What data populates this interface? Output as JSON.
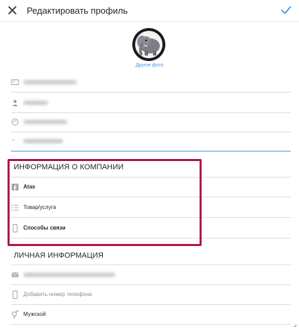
{
  "header": {
    "title": "Редактировать профиль",
    "close_icon": "close-icon",
    "save_icon": "checkmark-icon",
    "accent": "#3897f0"
  },
  "profile": {
    "change_photo": "Другое фото",
    "avatar_icon": "elephant-avatar"
  },
  "fields": {
    "name_icon": "id-card-icon",
    "username_icon": "person-icon",
    "website_icon": "globe-icon",
    "bio_icon": "quote-icon"
  },
  "company_section": {
    "title": "ИНФОРМАЦИЯ О КОМПАНИИ",
    "page": "Atas",
    "category": "Товар/услуга",
    "contacts": "Способы связи",
    "highlight_color": "#b0124f"
  },
  "personal_section": {
    "title": "ЛИЧНАЯ ИНФОРМАЦИЯ",
    "add_phone": "Добавить номер телефона",
    "gender": "Мужской"
  }
}
